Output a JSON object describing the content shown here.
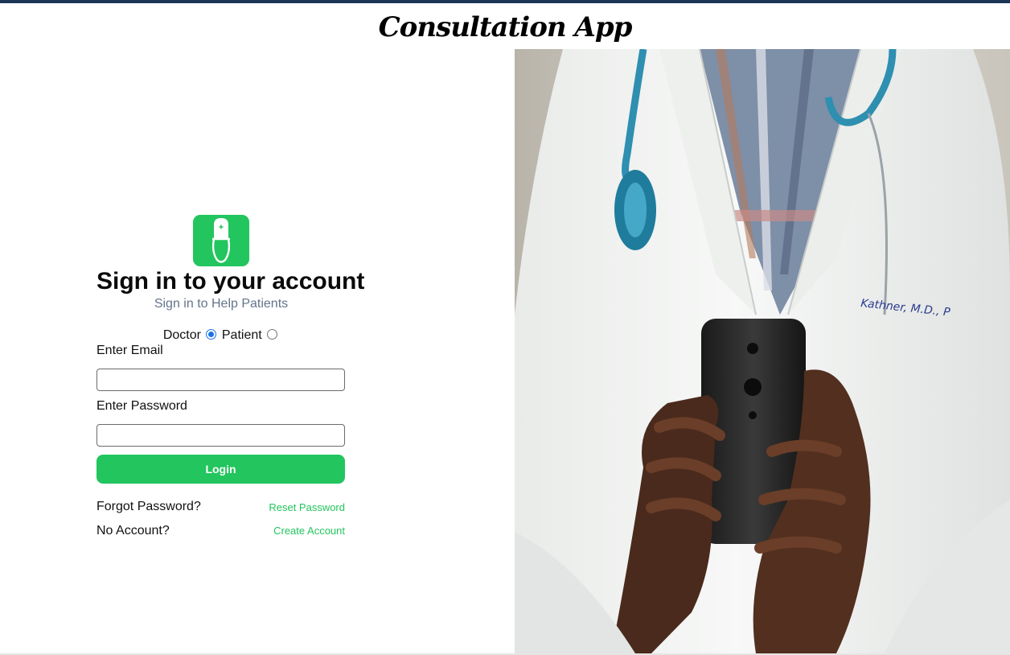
{
  "app": {
    "title": "Consultation App"
  },
  "colors": {
    "accent": "#22c55e",
    "topbar": "#1b3556",
    "subtle_text": "#64748b"
  },
  "logo": {
    "icon": "doctor-icon"
  },
  "signin": {
    "heading": "Sign in to your account",
    "subheading": "Sign in to Help Patients"
  },
  "role": {
    "doctor_label": "Doctor",
    "patient_label": "Patient",
    "selected": "Doctor"
  },
  "form": {
    "email_label": "Enter Email",
    "email_value": "",
    "password_label": "Enter Password",
    "password_value": "",
    "login_label": "Login"
  },
  "links": {
    "forgot_text": "Forgot Password?",
    "reset_label": "Reset Password",
    "no_account_text": "No Account?",
    "create_label": "Create Account"
  },
  "hero": {
    "image": "doctor-holding-phone-photo"
  }
}
